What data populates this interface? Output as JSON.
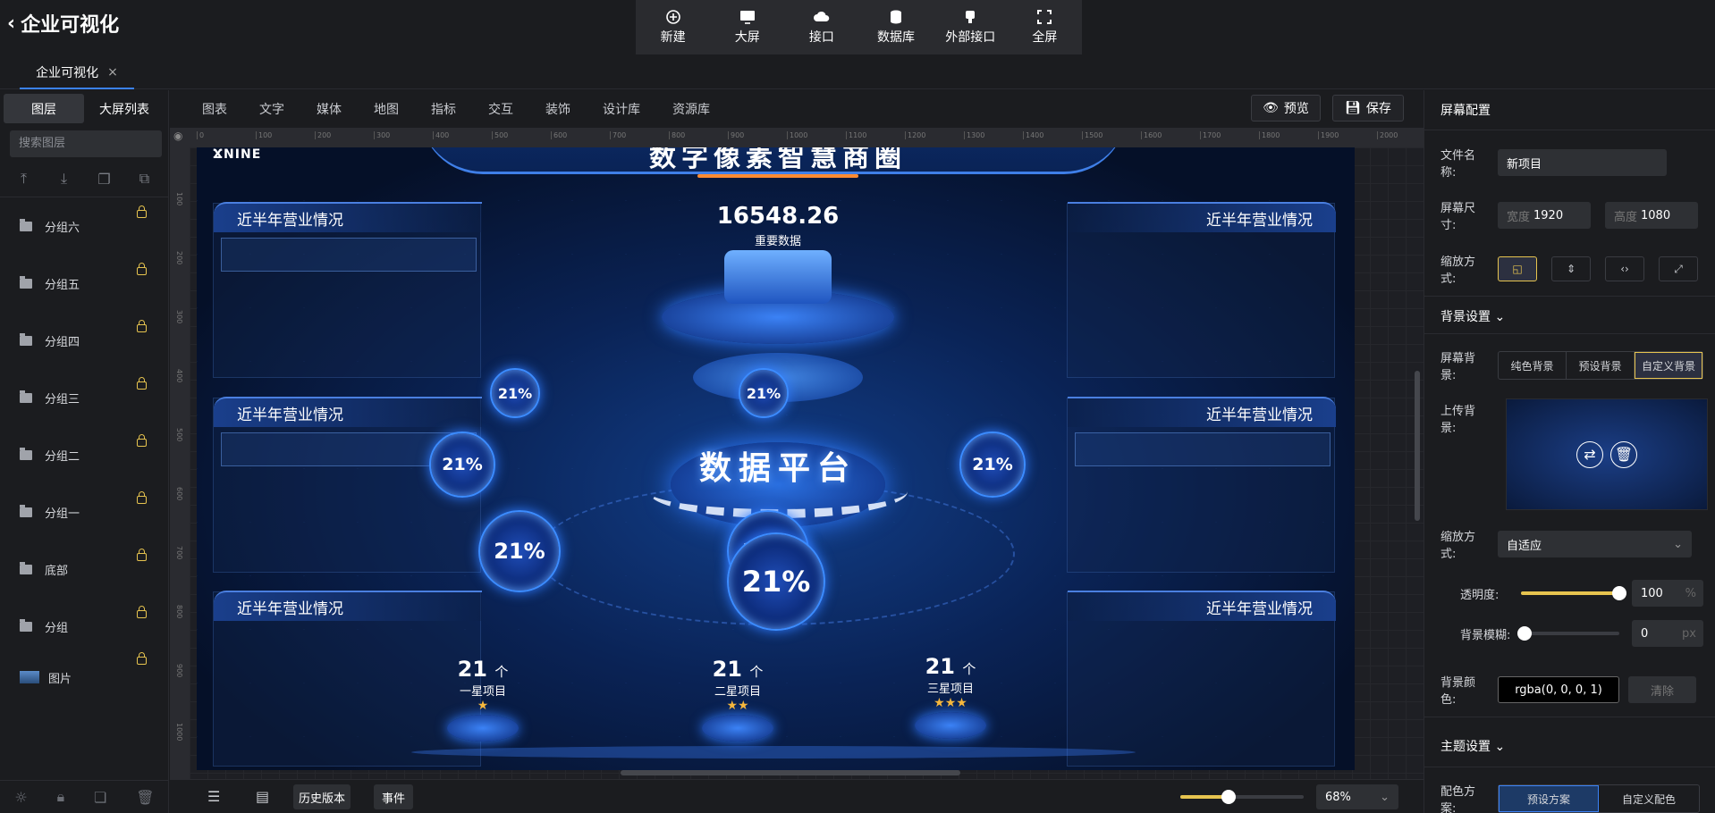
{
  "app": {
    "title": "企业可视化",
    "doc_tab": "企业可视化",
    "doc_tab_close": "×"
  },
  "toolbar": [
    {
      "label": "新建",
      "icon": "plus-circle-icon"
    },
    {
      "label": "大屏",
      "icon": "monitor-icon"
    },
    {
      "label": "接口",
      "icon": "cloud-code-icon"
    },
    {
      "label": "数据库",
      "icon": "database-icon"
    },
    {
      "label": "外部接口",
      "icon": "plug-icon"
    },
    {
      "label": "全屏",
      "icon": "fullscreen-icon"
    }
  ],
  "left_panel": {
    "tabs": [
      "图层",
      "大屏列表"
    ],
    "search_placeholder": "搜索图层",
    "layers": [
      "分组六",
      "分组五",
      "分组四",
      "分组三",
      "分组二",
      "分组一",
      "底部",
      "分组",
      "图片"
    ]
  },
  "components": [
    "图表",
    "文字",
    "媒体",
    "地图",
    "指标",
    "交互",
    "装饰",
    "设计库",
    "资源库"
  ],
  "actions": {
    "preview": "预览",
    "save": "保存"
  },
  "ruler_marks": [
    "0",
    "100",
    "200",
    "300",
    "400",
    "500",
    "600",
    "700",
    "800",
    "900",
    "1000",
    "1100",
    "1200",
    "1300",
    "1400",
    "1500",
    "1600",
    "1700",
    "1800",
    "1900",
    "2000"
  ],
  "ruler_v_marks": [
    "100",
    "200",
    "300",
    "400",
    "500",
    "600",
    "700",
    "800",
    "900",
    "1000"
  ],
  "screen": {
    "logo": "NINE",
    "title": "数字像素智慧商圈",
    "panel_title": "近半年营业情况",
    "main_value": "16548.26",
    "main_label": "重要数据",
    "platform": "数据平台",
    "percent": "21%",
    "stats": [
      {
        "value": "21",
        "arrow": "个",
        "label": "一星项目",
        "stars": 1
      },
      {
        "value": "21",
        "arrow": "个",
        "label": "二星项目",
        "stars": 2
      },
      {
        "value": "21",
        "arrow": "个",
        "label": "三星项目",
        "stars": 3
      }
    ]
  },
  "right_panel": {
    "header": "屏幕配置",
    "file_name_label": "文件名称:",
    "file_name": "新项目",
    "size_label": "屏幕尺寸:",
    "width_label": "宽度",
    "width": "1920",
    "height_label": "高度",
    "height": "1080",
    "scale_label": "缩放方式:",
    "bg_section": "背景设置",
    "bg_label": "屏幕背景:",
    "bg_options": [
      "纯色背景",
      "预设背景",
      "自定义背景"
    ],
    "bg_selected": "自定义背景",
    "upload_label": "上传背景:",
    "fit_label": "缩放方式:",
    "fit_value": "自适应",
    "opacity_label": "透明度:",
    "opacity": "100",
    "opacity_unit": "%",
    "blur_label": "背景模糊:",
    "blur": "0",
    "blur_unit": "px",
    "color_label": "背景颜色:",
    "color_value": "rgba(0, 0, 0, 1)",
    "clear": "清除",
    "theme_section": "主题设置",
    "scheme_label": "配色方案:",
    "scheme_options": [
      "预设方案",
      "自定义配色"
    ]
  },
  "bottom": {
    "history": "历史版本",
    "events": "事件",
    "zoom": "68%",
    "zoom_level": 0.39
  },
  "colors": {
    "accent": "#e7c44f",
    "panel_bg": "#1b1c1f",
    "screen_blue": "#0a2356"
  }
}
